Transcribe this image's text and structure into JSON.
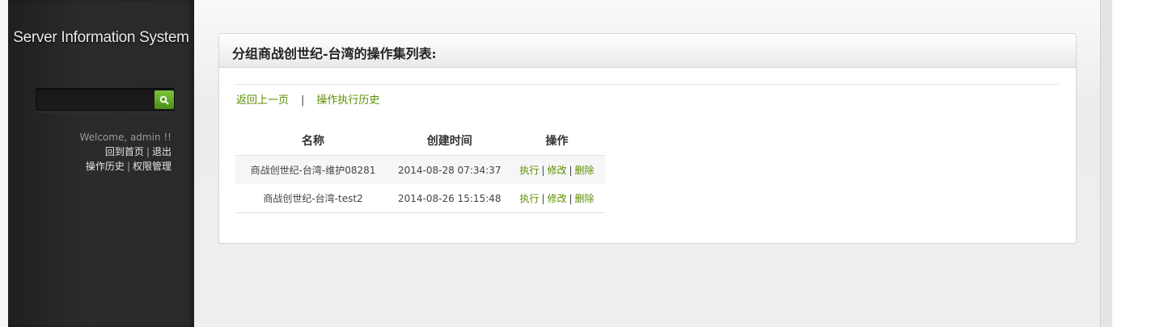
{
  "app": {
    "title": "Server Information System"
  },
  "sidebar": {
    "welcome": "Welcome, admin !!",
    "home_link": "回到首页",
    "logout_link": "退出",
    "history_link": "操作历史",
    "permission_link": "权限管理",
    "separator": "|"
  },
  "panel": {
    "title": "分组商战创世纪-台湾的操作集列表:",
    "back_link": "返回上一页",
    "links_separator": "|",
    "history_link": "操作执行历史"
  },
  "table": {
    "headers": [
      "名称",
      "创建时间",
      "操作"
    ],
    "rows": [
      {
        "name": "商战创世纪-台湾-维护08281",
        "created": "2014-08-28 07:34:37",
        "exec": "执行",
        "edit": "修改",
        "delete": "删除"
      },
      {
        "name": "商战创世纪-台湾-test2",
        "created": "2014-08-26 15:15:48",
        "exec": "执行",
        "edit": "修改",
        "delete": "删除"
      }
    ],
    "action_separator": "|"
  },
  "icons": {
    "search": "search-icon"
  },
  "colors": {
    "accent_green": "#5b8f00",
    "search_button": "#6ab62a",
    "sidebar_bg": "#2a2a2a"
  }
}
